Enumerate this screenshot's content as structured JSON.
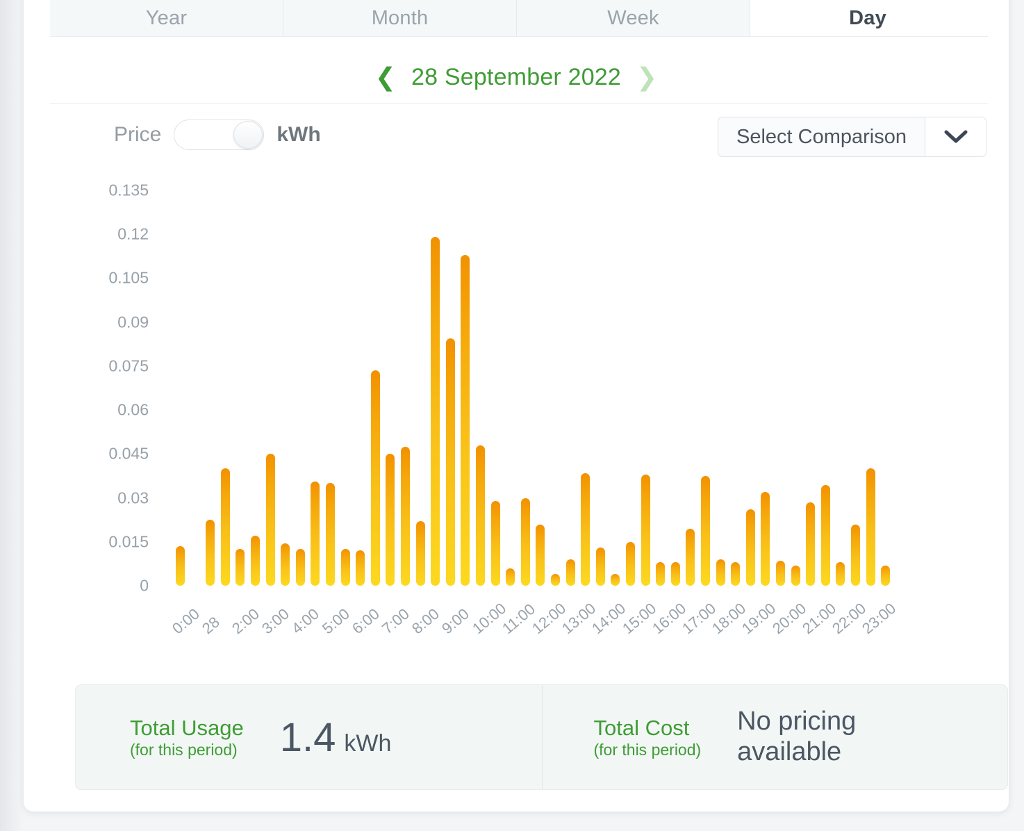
{
  "tabs": [
    {
      "label": "Year",
      "active": false
    },
    {
      "label": "Month",
      "active": false
    },
    {
      "label": "Week",
      "active": false
    },
    {
      "label": "Day",
      "active": true
    }
  ],
  "date_nav": {
    "prev_icon": "chevron-left-icon",
    "next_icon": "chevron-right-icon",
    "label": "28 September 2022"
  },
  "controls": {
    "toggle_left_label": "Price",
    "toggle_right_label": "kWh",
    "toggle_state": "kWh",
    "comparison_label": "Select Comparison",
    "comparison_icon": "chevron-down-icon"
  },
  "summary": {
    "usage_title": "Total Usage",
    "usage_sub": "(for this period)",
    "usage_value": "1.4",
    "usage_unit": "kWh",
    "cost_title": "Total Cost",
    "cost_sub": "(for this period)",
    "cost_value": "No pricing\navailable"
  },
  "colors": {
    "green": "#3f9c35",
    "green_light": "#bfe3b8",
    "bar_top": "#F29100",
    "bar_bottom": "#FCD920",
    "text_dark": "#4c5764",
    "text_muted": "#9aa3ab"
  },
  "chart_data": {
    "type": "bar",
    "title": "",
    "xlabel": "",
    "ylabel": "",
    "unit": "kWh",
    "ylim": [
      0,
      0.135
    ],
    "yticks": [
      "0.135",
      "0.12",
      "0.105",
      "0.09",
      "0.075",
      "0.06",
      "0.045",
      "0.03",
      "0.015",
      "0"
    ],
    "ytick_values": [
      0.135,
      0.12,
      0.105,
      0.09,
      0.075,
      0.06,
      0.045,
      0.03,
      0.015,
      0
    ],
    "grid": false,
    "legend": "none",
    "categories": [
      "0:00",
      "28",
      "2:00",
      "3:00",
      "4:00",
      "5:00",
      "6:00",
      "7:00",
      "8:00",
      "9:00",
      "10:00",
      "11:00",
      "12:00",
      "13:00",
      "14:00",
      "15:00",
      "16:00",
      "17:00",
      "18:00",
      "19:00",
      "20:00",
      "21:00",
      "22:00",
      "23:00"
    ],
    "bar_interval_minutes": 30,
    "x": [
      "0:00",
      "0:30",
      "1:00",
      "1:30",
      "2:00",
      "2:30",
      "3:00",
      "3:30",
      "4:00",
      "4:30",
      "5:00",
      "5:30",
      "6:00",
      "6:30",
      "7:00",
      "7:30",
      "8:00",
      "8:30",
      "9:00",
      "9:30",
      "10:00",
      "10:30",
      "11:00",
      "11:30",
      "12:00",
      "12:30",
      "13:00",
      "13:30",
      "14:00",
      "14:30",
      "15:00",
      "15:30",
      "16:00",
      "16:30",
      "17:00",
      "17:30",
      "18:00",
      "18:30",
      "19:00",
      "19:30",
      "20:00",
      "20:30",
      "21:00",
      "21:30",
      "22:00",
      "22:30",
      "23:00",
      "23:30"
    ],
    "values": [
      0.0135,
      0.0,
      0.0225,
      0.04,
      0.0125,
      0.017,
      0.045,
      0.0145,
      0.0125,
      0.0355,
      0.035,
      0.0125,
      0.012,
      0.0735,
      0.045,
      0.0475,
      0.022,
      0.119,
      0.0845,
      0.113,
      0.048,
      0.029,
      0.006,
      0.03,
      0.021,
      0.004,
      0.009,
      0.0385,
      0.013,
      0.004,
      0.015,
      0.038,
      0.008,
      0.008,
      0.0195,
      0.0375,
      0.009,
      0.008,
      0.026,
      0.032,
      0.0085,
      0.007,
      0.0285,
      0.0345,
      0.008,
      0.021,
      0.04,
      0.007
    ],
    "series": [
      {
        "name": "Usage",
        "values": [
          0.0135,
          0.0,
          0.0225,
          0.04,
          0.0125,
          0.017,
          0.045,
          0.0145,
          0.0125,
          0.0355,
          0.035,
          0.0125,
          0.012,
          0.0735,
          0.045,
          0.0475,
          0.022,
          0.119,
          0.0845,
          0.113,
          0.048,
          0.029,
          0.006,
          0.03,
          0.021,
          0.004,
          0.009,
          0.0385,
          0.013,
          0.004,
          0.015,
          0.038,
          0.008,
          0.008,
          0.0195,
          0.0375,
          0.009,
          0.008,
          0.026,
          0.032,
          0.0085,
          0.007,
          0.0285,
          0.0345,
          0.008,
          0.021,
          0.04,
          0.007
        ]
      }
    ]
  }
}
